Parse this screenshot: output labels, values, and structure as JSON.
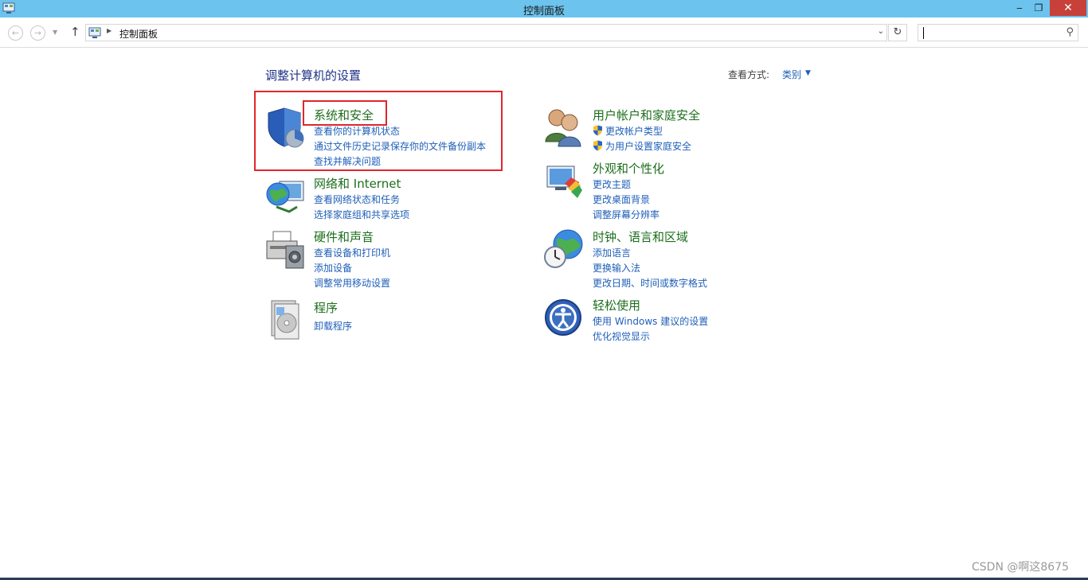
{
  "window": {
    "title": "控制面板"
  },
  "titlebar_controls": {
    "minimize": "‒",
    "maximize": "❐",
    "close": "✕"
  },
  "navbar": {
    "back_glyph": "←",
    "forward_glyph": "→",
    "recent_glyph": "▼",
    "up_glyph": "↑",
    "breadcrumb": "控制面板",
    "refresh_glyph": "↻",
    "search_glyph": "⚲"
  },
  "main": {
    "heading": "调整计算机的设置",
    "view_by_label": "查看方式:",
    "view_by_value": "类别",
    "view_by_arrow": "▼"
  },
  "categories": [
    {
      "title": "系统和安全",
      "icon": "shield-icon",
      "links": [
        "查看你的计算机状态",
        "通过文件历史记录保存你的文件备份副本",
        "查找并解决问题"
      ]
    },
    {
      "title": "网络和 Internet",
      "icon": "network-globe-icon",
      "links": [
        "查看网络状态和任务",
        "选择家庭组和共享选项"
      ]
    },
    {
      "title": "硬件和声音",
      "icon": "printer-icon",
      "links": [
        "查看设备和打印机",
        "添加设备",
        "调整常用移动设置"
      ]
    },
    {
      "title": "程序",
      "icon": "programs-icon",
      "links": [
        "卸载程序"
      ]
    },
    {
      "title": "用户帐户和家庭安全",
      "icon": "users-icon",
      "links": [
        "更改帐户类型",
        "为用户设置家庭安全"
      ]
    },
    {
      "title": "外观和个性化",
      "icon": "monitor-palette-icon",
      "links": [
        "更改主题",
        "更改桌面背景",
        "调整屏幕分辨率"
      ]
    },
    {
      "title": "时钟、语言和区域",
      "icon": "clock-globe-icon",
      "links": [
        "添加语言",
        "更换输入法",
        "更改日期、时间或数字格式"
      ]
    },
    {
      "title": "轻松使用",
      "icon": "ease-of-access-icon",
      "links": [
        "使用 Windows 建议的设置",
        "优化视觉显示"
      ]
    }
  ],
  "watermark": "CSDN @啊这8675",
  "colors": {
    "titlebar": "#6cc3ee",
    "category_title": "#1c6e1c",
    "link": "#1f5fb8",
    "highlight": "#e0262c"
  }
}
